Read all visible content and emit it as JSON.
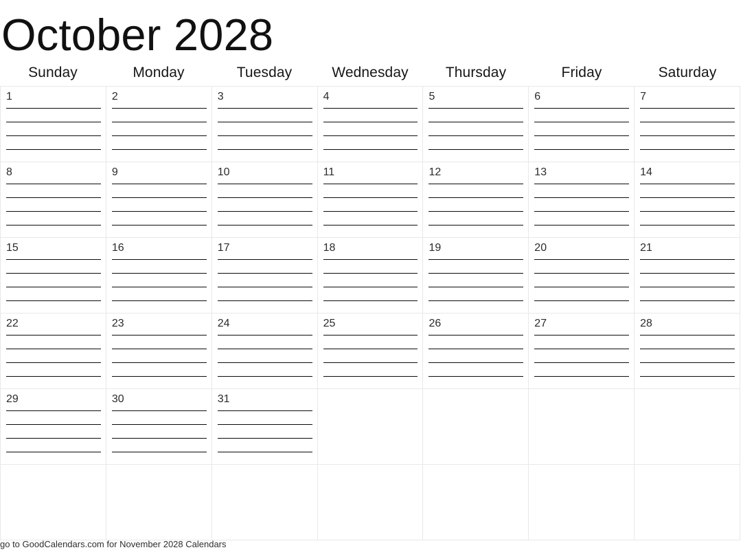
{
  "header": {
    "title": "October 2028",
    "month": "October",
    "year": "2028"
  },
  "weekdays": [
    {
      "label": "Sunday"
    },
    {
      "label": "Monday"
    },
    {
      "label": "Tuesday"
    },
    {
      "label": "Wednesday"
    },
    {
      "label": "Thursday"
    },
    {
      "label": "Friday"
    },
    {
      "label": "Saturday"
    }
  ],
  "grid": {
    "rows": 6,
    "columns": 7,
    "lines_per_day": 4,
    "weeks": [
      [
        {
          "date": "1"
        },
        {
          "date": "2"
        },
        {
          "date": "3"
        },
        {
          "date": "4"
        },
        {
          "date": "5"
        },
        {
          "date": "6"
        },
        {
          "date": "7"
        }
      ],
      [
        {
          "date": "8"
        },
        {
          "date": "9"
        },
        {
          "date": "10"
        },
        {
          "date": "11"
        },
        {
          "date": "12"
        },
        {
          "date": "13"
        },
        {
          "date": "14"
        }
      ],
      [
        {
          "date": "15"
        },
        {
          "date": "16"
        },
        {
          "date": "17"
        },
        {
          "date": "18"
        },
        {
          "date": "19"
        },
        {
          "date": "20"
        },
        {
          "date": "21"
        }
      ],
      [
        {
          "date": "22"
        },
        {
          "date": "23"
        },
        {
          "date": "24"
        },
        {
          "date": "25"
        },
        {
          "date": "26"
        },
        {
          "date": "27"
        },
        {
          "date": "28"
        }
      ],
      [
        {
          "date": "29"
        },
        {
          "date": "30"
        },
        {
          "date": "31"
        },
        {
          "date": ""
        },
        {
          "date": ""
        },
        {
          "date": ""
        },
        {
          "date": ""
        }
      ],
      [
        {
          "date": ""
        },
        {
          "date": ""
        },
        {
          "date": ""
        },
        {
          "date": ""
        },
        {
          "date": ""
        },
        {
          "date": ""
        },
        {
          "date": ""
        }
      ]
    ]
  },
  "footer": {
    "note": "go to GoodCalendars.com for November 2028 Calendars"
  },
  "colors": {
    "page_background": "#ffffff",
    "grid_border": "#e8e8e8",
    "rule_line": "#0b0b0b",
    "title_text": "#111111",
    "day_number_text": "#2b2b2b",
    "footer_text": "#2e2e2e"
  }
}
